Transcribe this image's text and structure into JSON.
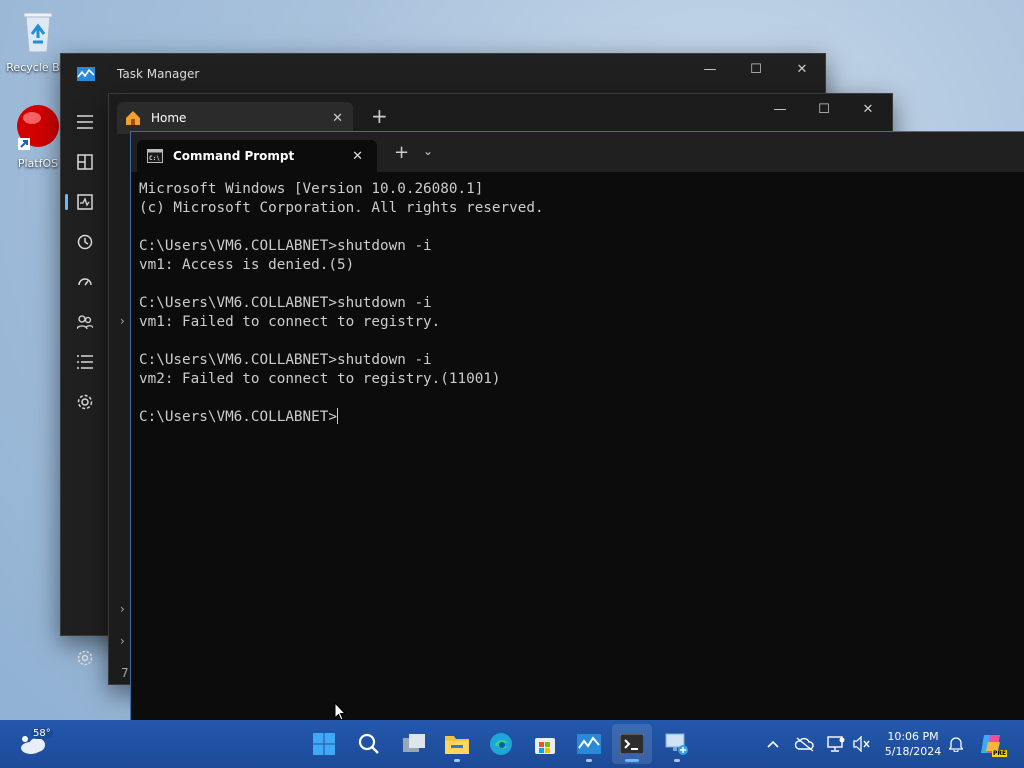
{
  "desktop": {
    "icons": [
      {
        "label": "Recycle Bin",
        "icon": "recycle-bin-icon"
      },
      {
        "label": "PlatfOS",
        "icon": "red-ball-icon"
      }
    ]
  },
  "task_manager": {
    "title": "Task Manager",
    "nav": [
      "hamburger-icon",
      "processes-icon",
      "performance-icon",
      "app-history-icon",
      "startup-apps-icon",
      "users-icon",
      "details-icon",
      "services-icon",
      "settings-icon"
    ],
    "partial_text": "7"
  },
  "explorer": {
    "tab_label": "Home",
    "new_tab": "+"
  },
  "terminal": {
    "tab_label": "Command Prompt",
    "new_tab": "+",
    "lines": [
      "Microsoft Windows [Version 10.0.26080.1]",
      "(c) Microsoft Corporation. All rights reserved.",
      "",
      "C:\\Users\\VM6.COLLABNET>shutdown -i",
      "vm1: Access is denied.(5)",
      "",
      "C:\\Users\\VM6.COLLABNET>shutdown -i",
      "vm1: Failed to connect to registry.",
      "",
      "C:\\Users\\VM6.COLLABNET>shutdown -i",
      "vm2: Failed to connect to registry.(11001)",
      ""
    ],
    "prompt": "C:\\Users\\VM6.COLLABNET>"
  },
  "taskbar": {
    "weather_temp": "58°",
    "apps": [
      "start-icon",
      "search-icon",
      "task-view-icon",
      "file-explorer-icon",
      "edge-icon",
      "store-icon",
      "task-manager-icon",
      "terminal-icon",
      "remote-desktop-icon"
    ],
    "time": "10:06 PM",
    "date": "5/18/2024",
    "badge": "PRE"
  }
}
